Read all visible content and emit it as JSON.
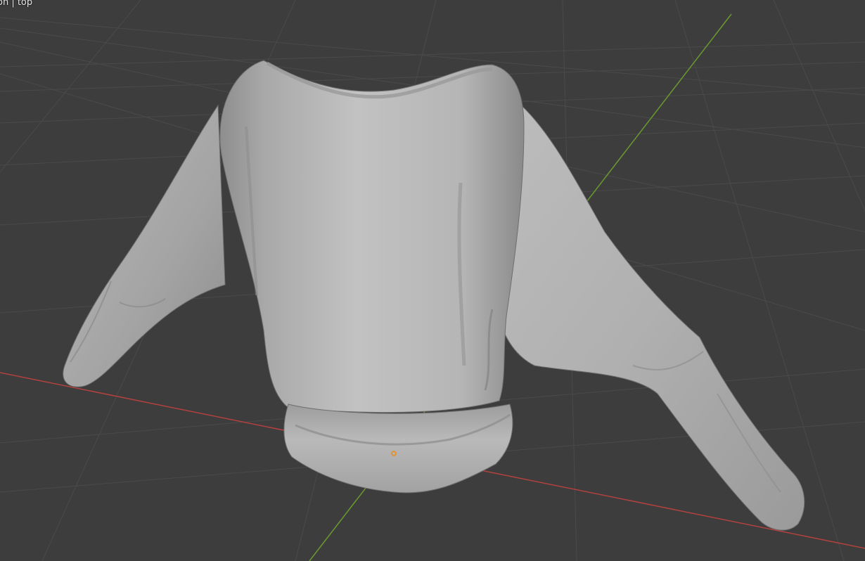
{
  "viewport": {
    "overlay_text": "on | top",
    "background_color": "#3d3d3d",
    "grid_line_color": "#4a4a4a",
    "x_axis_color": "#b3423f",
    "y_axis_color": "#6a9a2e",
    "origin_marker_color": "#f08a10"
  },
  "object": {
    "type": "cloth-mesh-sweater",
    "shading": "solid",
    "base_color": "#b7b7b7"
  }
}
